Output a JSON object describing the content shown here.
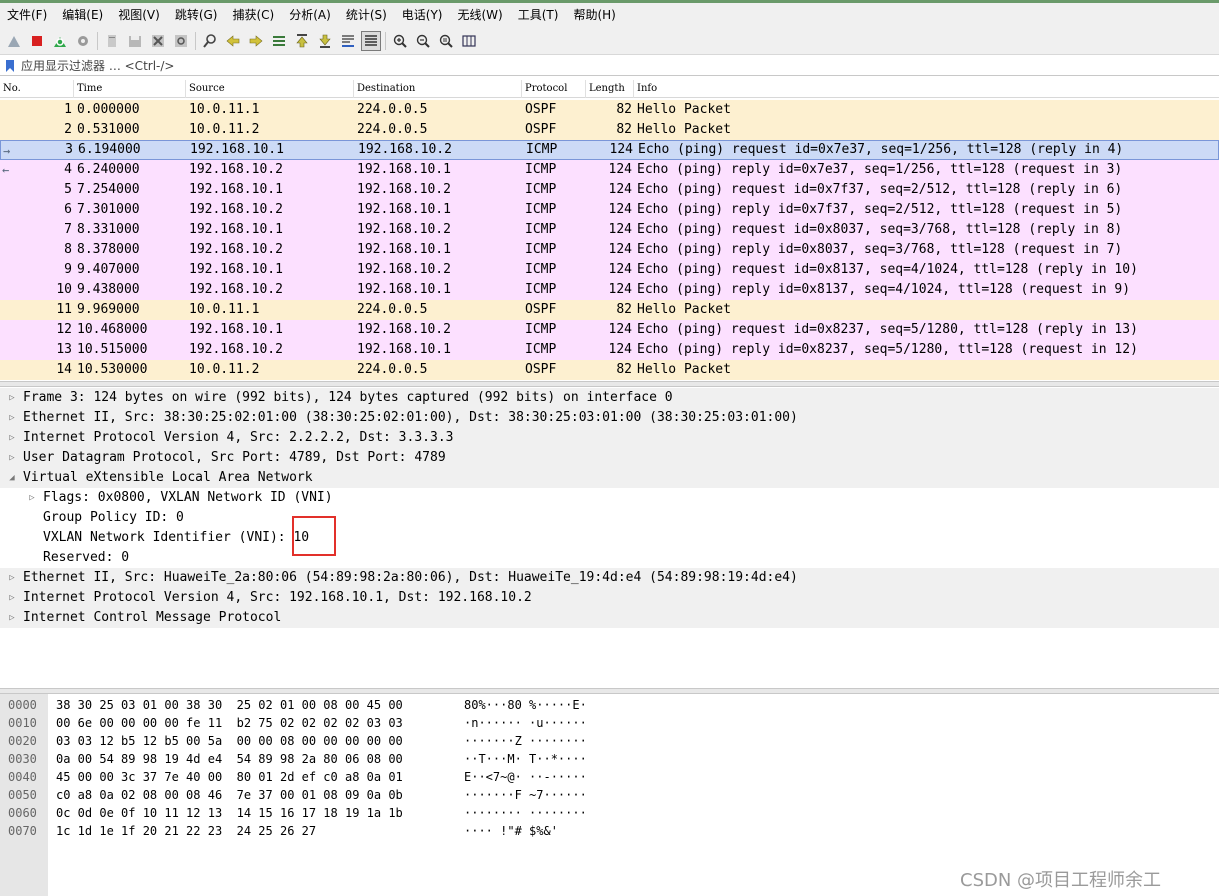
{
  "menu": [
    "文件(F)",
    "编辑(E)",
    "视图(V)",
    "跳转(G)",
    "捕获(C)",
    "分析(A)",
    "统计(S)",
    "电话(Y)",
    "无线(W)",
    "工具(T)",
    "帮助(H)"
  ],
  "toolbar_icons": [
    "shark-fin-start-icon",
    "stop-square-icon",
    "restart-capture-icon",
    "capture-options-gear-icon",
    "open-file-icon",
    "save-file-icon",
    "close-file-icon",
    "reload-file-icon",
    "find-packet-icon",
    "go-back-arrow-icon",
    "go-forward-arrow-icon",
    "go-to-packet-icon",
    "go-first-packet-icon",
    "go-last-packet-icon",
    "auto-scroll-icon",
    "colorize-list-icon",
    "zoom-in-icon",
    "zoom-out-icon",
    "zoom-normal-icon",
    "resize-columns-icon"
  ],
  "filter": {
    "placeholder": "应用显示过滤器 … <Ctrl-/>"
  },
  "columns": {
    "no": "No.",
    "time": "Time",
    "source": "Source",
    "destination": "Destination",
    "protocol": "Protocol",
    "length": "Length",
    "info": "Info"
  },
  "colors": {
    "ospf_row": "#fdf0d0",
    "icmp_row": "#fce0ff",
    "selected_row": "#ccdaf6",
    "highlight_box": "#e2302a"
  },
  "packets": [
    {
      "no": "1",
      "time": "0.000000",
      "src": "10.0.11.1",
      "dst": "224.0.0.5",
      "proto": "OSPF",
      "len": "82",
      "info": "Hello Packet",
      "kind": "ospf"
    },
    {
      "no": "2",
      "time": "0.531000",
      "src": "10.0.11.2",
      "dst": "224.0.0.5",
      "proto": "OSPF",
      "len": "82",
      "info": "Hello Packet",
      "kind": "ospf"
    },
    {
      "no": "3",
      "time": "6.194000",
      "src": "192.168.10.1",
      "dst": "192.168.10.2",
      "proto": "ICMP",
      "len": "124",
      "info": "Echo (ping) request  id=0x7e37, seq=1/256, ttl=128 (reply in 4)",
      "kind": "selected",
      "arrow": "→"
    },
    {
      "no": "4",
      "time": "6.240000",
      "src": "192.168.10.2",
      "dst": "192.168.10.1",
      "proto": "ICMP",
      "len": "124",
      "info": "Echo (ping) reply    id=0x7e37, seq=1/256, ttl=128 (request in 3)",
      "kind": "icmp",
      "arrow": "←"
    },
    {
      "no": "5",
      "time": "7.254000",
      "src": "192.168.10.1",
      "dst": "192.168.10.2",
      "proto": "ICMP",
      "len": "124",
      "info": "Echo (ping) request  id=0x7f37, seq=2/512, ttl=128 (reply in 6)",
      "kind": "icmp"
    },
    {
      "no": "6",
      "time": "7.301000",
      "src": "192.168.10.2",
      "dst": "192.168.10.1",
      "proto": "ICMP",
      "len": "124",
      "info": "Echo (ping) reply    id=0x7f37, seq=2/512, ttl=128 (request in 5)",
      "kind": "icmp"
    },
    {
      "no": "7",
      "time": "8.331000",
      "src": "192.168.10.1",
      "dst": "192.168.10.2",
      "proto": "ICMP",
      "len": "124",
      "info": "Echo (ping) request  id=0x8037, seq=3/768, ttl=128 (reply in 8)",
      "kind": "icmp"
    },
    {
      "no": "8",
      "time": "8.378000",
      "src": "192.168.10.2",
      "dst": "192.168.10.1",
      "proto": "ICMP",
      "len": "124",
      "info": "Echo (ping) reply    id=0x8037, seq=3/768, ttl=128 (request in 7)",
      "kind": "icmp"
    },
    {
      "no": "9",
      "time": "9.407000",
      "src": "192.168.10.1",
      "dst": "192.168.10.2",
      "proto": "ICMP",
      "len": "124",
      "info": "Echo (ping) request  id=0x8137, seq=4/1024, ttl=128 (reply in 10)",
      "kind": "icmp"
    },
    {
      "no": "10",
      "time": "9.438000",
      "src": "192.168.10.2",
      "dst": "192.168.10.1",
      "proto": "ICMP",
      "len": "124",
      "info": "Echo (ping) reply    id=0x8137, seq=4/1024, ttl=128 (request in 9)",
      "kind": "icmp"
    },
    {
      "no": "11",
      "time": "9.969000",
      "src": "10.0.11.1",
      "dst": "224.0.0.5",
      "proto": "OSPF",
      "len": "82",
      "info": "Hello Packet",
      "kind": "ospf"
    },
    {
      "no": "12",
      "time": "10.468000",
      "src": "192.168.10.1",
      "dst": "192.168.10.2",
      "proto": "ICMP",
      "len": "124",
      "info": "Echo (ping) request  id=0x8237, seq=5/1280, ttl=128 (reply in 13)",
      "kind": "icmp"
    },
    {
      "no": "13",
      "time": "10.515000",
      "src": "192.168.10.2",
      "dst": "192.168.10.1",
      "proto": "ICMP",
      "len": "124",
      "info": "Echo (ping) reply    id=0x8237, seq=5/1280, ttl=128 (request in 12)",
      "kind": "icmp"
    },
    {
      "no": "14",
      "time": "10.530000",
      "src": "10.0.11.2",
      "dst": "224.0.0.5",
      "proto": "OSPF",
      "len": "82",
      "info": "Hello Packet",
      "kind": "ospf"
    }
  ],
  "details": [
    {
      "text": "Frame 3: 124 bytes on wire (992 bits), 124 bytes captured (992 bits) on interface 0",
      "level": 0,
      "toggle": "collapsed",
      "grey": true
    },
    {
      "text": "Ethernet II, Src: 38:30:25:02:01:00 (38:30:25:02:01:00), Dst: 38:30:25:03:01:00 (38:30:25:03:01:00)",
      "level": 0,
      "toggle": "collapsed",
      "grey": true
    },
    {
      "text": "Internet Protocol Version 4, Src: 2.2.2.2, Dst: 3.3.3.3",
      "level": 0,
      "toggle": "collapsed",
      "grey": true
    },
    {
      "text": "User Datagram Protocol, Src Port: 4789, Dst Port: 4789",
      "level": 0,
      "toggle": "collapsed",
      "grey": true
    },
    {
      "text": "Virtual eXtensible Local Area Network",
      "level": 0,
      "toggle": "expanded",
      "grey": true
    },
    {
      "text": "Flags: 0x0800, VXLAN Network ID (VNI)",
      "level": 1,
      "toggle": "collapsed",
      "grey": false
    },
    {
      "text": "Group Policy ID: 0",
      "level": 1,
      "toggle": "none",
      "grey": false
    },
    {
      "text": "VXLAN Network Identifier (VNI): 10",
      "level": 1,
      "toggle": "none",
      "grey": false
    },
    {
      "text": "Reserved: 0",
      "level": 1,
      "toggle": "none",
      "grey": false
    },
    {
      "text": "Ethernet II, Src: HuaweiTe_2a:80:06 (54:89:98:2a:80:06), Dst: HuaweiTe_19:4d:e4 (54:89:98:19:4d:e4)",
      "level": 0,
      "toggle": "collapsed",
      "grey": true
    },
    {
      "text": "Internet Protocol Version 4, Src: 192.168.10.1, Dst: 192.168.10.2",
      "level": 0,
      "toggle": "collapsed",
      "grey": true
    },
    {
      "text": "Internet Control Message Protocol",
      "level": 0,
      "toggle": "collapsed",
      "grey": true
    }
  ],
  "hex": [
    {
      "off": "0000",
      "bytes": "38 30 25 03 01 00 38 30  25 02 01 00 08 00 45 00",
      "ascii": "80%···80 %·····E·"
    },
    {
      "off": "0010",
      "bytes": "00 6e 00 00 00 00 fe 11  b2 75 02 02 02 02 03 03",
      "ascii": "·n······ ·u······"
    },
    {
      "off": "0020",
      "bytes": "03 03 12 b5 12 b5 00 5a  00 00 08 00 00 00 00 00",
      "ascii": "·······Z ········"
    },
    {
      "off": "0030",
      "bytes": "0a 00 54 89 98 19 4d e4  54 89 98 2a 80 06 08 00",
      "ascii": "··T···M· T··*····"
    },
    {
      "off": "0040",
      "bytes": "45 00 00 3c 37 7e 40 00  80 01 2d ef c0 a8 0a 01",
      "ascii": "E··<7~@· ··-·····"
    },
    {
      "off": "0050",
      "bytes": "c0 a8 0a 02 08 00 08 46  7e 37 00 01 08 09 0a 0b",
      "ascii": "·······F ~7······"
    },
    {
      "off": "0060",
      "bytes": "0c 0d 0e 0f 10 11 12 13  14 15 16 17 18 19 1a 1b",
      "ascii": "········ ········"
    },
    {
      "off": "0070",
      "bytes": "1c 1d 1e 1f 20 21 22 23  24 25 26 27",
      "ascii": "···· !\"# $%&'"
    }
  ],
  "watermark": "CSDN @项目工程师余工"
}
